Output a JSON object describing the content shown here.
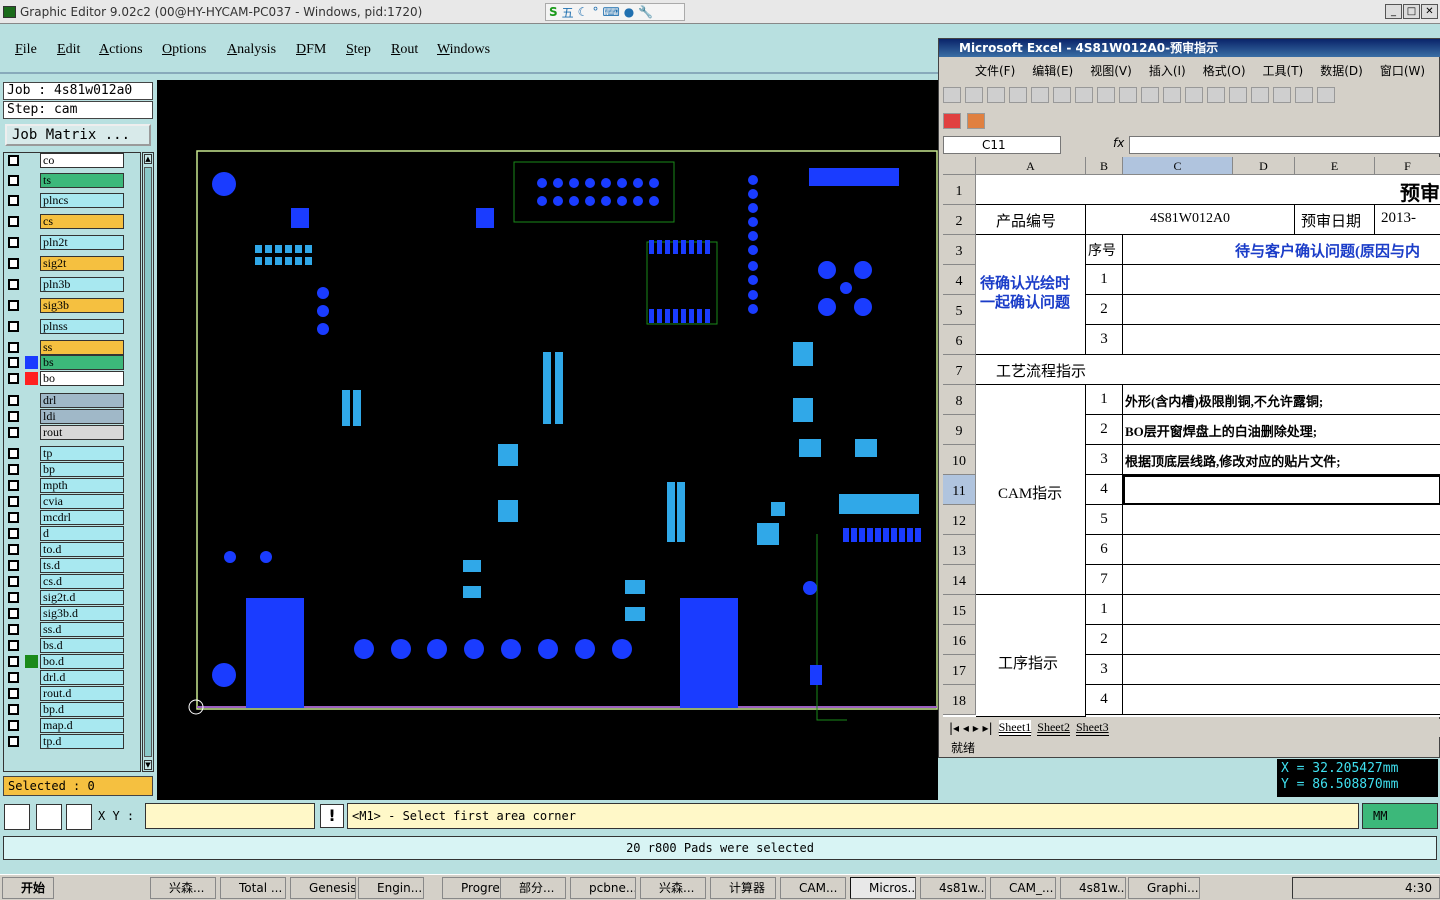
{
  "window": {
    "title": "Graphic Editor 9.02c2 (00@HY-HYCAM-PC037 - Windows, pid:1720)"
  },
  "ime": {
    "label": "五"
  },
  "menu": [
    "File",
    "Edit",
    "Actions",
    "Options",
    "Analysis",
    "DFM",
    "Step",
    "Rout",
    "Windows"
  ],
  "job": {
    "job_line": "Job : 4s81w012a0",
    "step_line": "Step: cam",
    "matrix_button": "Job Matrix ..."
  },
  "layers": [
    {
      "name": "co",
      "color": "#ffffff",
      "swatch": ""
    },
    {
      "name": "ts",
      "color": "#3cb87a",
      "swatch": ""
    },
    {
      "name": "plncs",
      "color": "#a8e8f0",
      "swatch": ""
    },
    {
      "name": "cs",
      "color": "#f5c040",
      "swatch": ""
    },
    {
      "name": "pln2t",
      "color": "#a8e8f0",
      "swatch": ""
    },
    {
      "name": "sig2t",
      "color": "#f5c040",
      "swatch": ""
    },
    {
      "name": "pln3b",
      "color": "#a8e8f0",
      "swatch": ""
    },
    {
      "name": "sig3b",
      "color": "#f5c040",
      "swatch": ""
    },
    {
      "name": "plnss",
      "color": "#a8e8f0",
      "swatch": ""
    },
    {
      "name": "ss",
      "color": "#f5c040",
      "swatch": ""
    },
    {
      "name": "bs",
      "color": "#3cb87a",
      "swatch": "#1a3cff"
    },
    {
      "name": "bo",
      "color": "#ffffff",
      "swatch": "#ff2020"
    },
    {
      "name": "drl",
      "color": "#a0b8c8",
      "swatch": ""
    },
    {
      "name": "ldi",
      "color": "#a0b8c8",
      "swatch": ""
    },
    {
      "name": "rout",
      "color": "#d8d8d8",
      "swatch": ""
    },
    {
      "name": "tp",
      "color": "#a8e8f0",
      "swatch": ""
    },
    {
      "name": "bp",
      "color": "#a8e8f0",
      "swatch": ""
    },
    {
      "name": "mpth",
      "color": "#a8e8f0",
      "swatch": ""
    },
    {
      "name": "cvia",
      "color": "#a8e8f0",
      "swatch": ""
    },
    {
      "name": "mcdrl",
      "color": "#a8e8f0",
      "swatch": ""
    },
    {
      "name": "d",
      "color": "#a8e8f0",
      "swatch": ""
    },
    {
      "name": "to.d",
      "color": "#a8e8f0",
      "swatch": ""
    },
    {
      "name": "ts.d",
      "color": "#a8e8f0",
      "swatch": ""
    },
    {
      "name": "cs.d",
      "color": "#a8e8f0",
      "swatch": ""
    },
    {
      "name": "sig2t.d",
      "color": "#a8e8f0",
      "swatch": ""
    },
    {
      "name": "sig3b.d",
      "color": "#a8e8f0",
      "swatch": ""
    },
    {
      "name": "ss.d",
      "color": "#a8e8f0",
      "swatch": ""
    },
    {
      "name": "bs.d",
      "color": "#a8e8f0",
      "swatch": ""
    },
    {
      "name": "bo.d",
      "color": "#a8e8f0",
      "swatch": "#1a8a1a"
    },
    {
      "name": "drl.d",
      "color": "#a8e8f0",
      "swatch": ""
    },
    {
      "name": "rout.d",
      "color": "#a8e8f0",
      "swatch": ""
    },
    {
      "name": "bp.d",
      "color": "#a8e8f0",
      "swatch": ""
    },
    {
      "name": "map.d",
      "color": "#a8e8f0",
      "swatch": ""
    },
    {
      "name": "tp.d",
      "color": "#a8e8f0",
      "swatch": ""
    }
  ],
  "selected": "Selected : 0",
  "excel": {
    "title": "Microsoft Excel - 4S81W012A0-预审指示",
    "menu": [
      "文件(F)",
      "编辑(E)",
      "视图(V)",
      "插入(I)",
      "格式(O)",
      "工具(T)",
      "数据(D)",
      "窗口(W)"
    ],
    "name_box": "C11",
    "fx": "fx",
    "columns": [
      "A",
      "B",
      "C",
      "D",
      "E",
      "F"
    ],
    "rows": [
      "1",
      "2",
      "3",
      "4",
      "5",
      "6",
      "7",
      "8",
      "9",
      "10",
      "11",
      "12",
      "13",
      "14",
      "15",
      "16",
      "17",
      "18"
    ],
    "title_cell": "预审",
    "product_label": "产品编号",
    "product_value": "4S81W012A0",
    "review_date_label": "预审日期",
    "review_date_value": "2013-",
    "seq_label": "序号",
    "pending_header": "待与客户确认问题(原因与内",
    "pending_label": "待确认光绘时一起确认问题",
    "process_label": "工艺流程指示",
    "cam_label": "CAM指示",
    "op_label": "工序指示",
    "cam_items": [
      "外形(含内槽)极限削铜,不允许露铜;",
      "BO层开窗焊盘上的白油删除处理;",
      "根据顶底层线路,修改对应的贴片文件;"
    ],
    "nums": [
      "1",
      "2",
      "3",
      "4",
      "5",
      "6",
      "7"
    ],
    "sheets": [
      "Sheet1",
      "Sheet2",
      "Sheet3"
    ],
    "status": "就绪"
  },
  "coords": {
    "x": "X = 32.205427mm",
    "y": "Y = 86.508870mm"
  },
  "xy_label": "X Y :",
  "warn": "!",
  "message": "<M1> - Select first area corner",
  "unit": "MM",
  "status": "20 r800 Pads were selected",
  "taskbar": {
    "start": "开始",
    "tasks": [
      "兴森...",
      "Total ...",
      "Genesis",
      "Engin...",
      "Progress",
      "部分...",
      "pcbne...",
      "兴森...",
      "计算器",
      "CAM...",
      "Micros...",
      "4s81w...",
      "CAM_...",
      "4s81w...",
      "Graphi..."
    ],
    "clock": "4:30"
  },
  "colors": {
    "pad_blue": "#1a3cff",
    "pad_cyan": "#30a8e8",
    "silk_green": "#1a8a1a",
    "board_outline": "#c8e890"
  }
}
